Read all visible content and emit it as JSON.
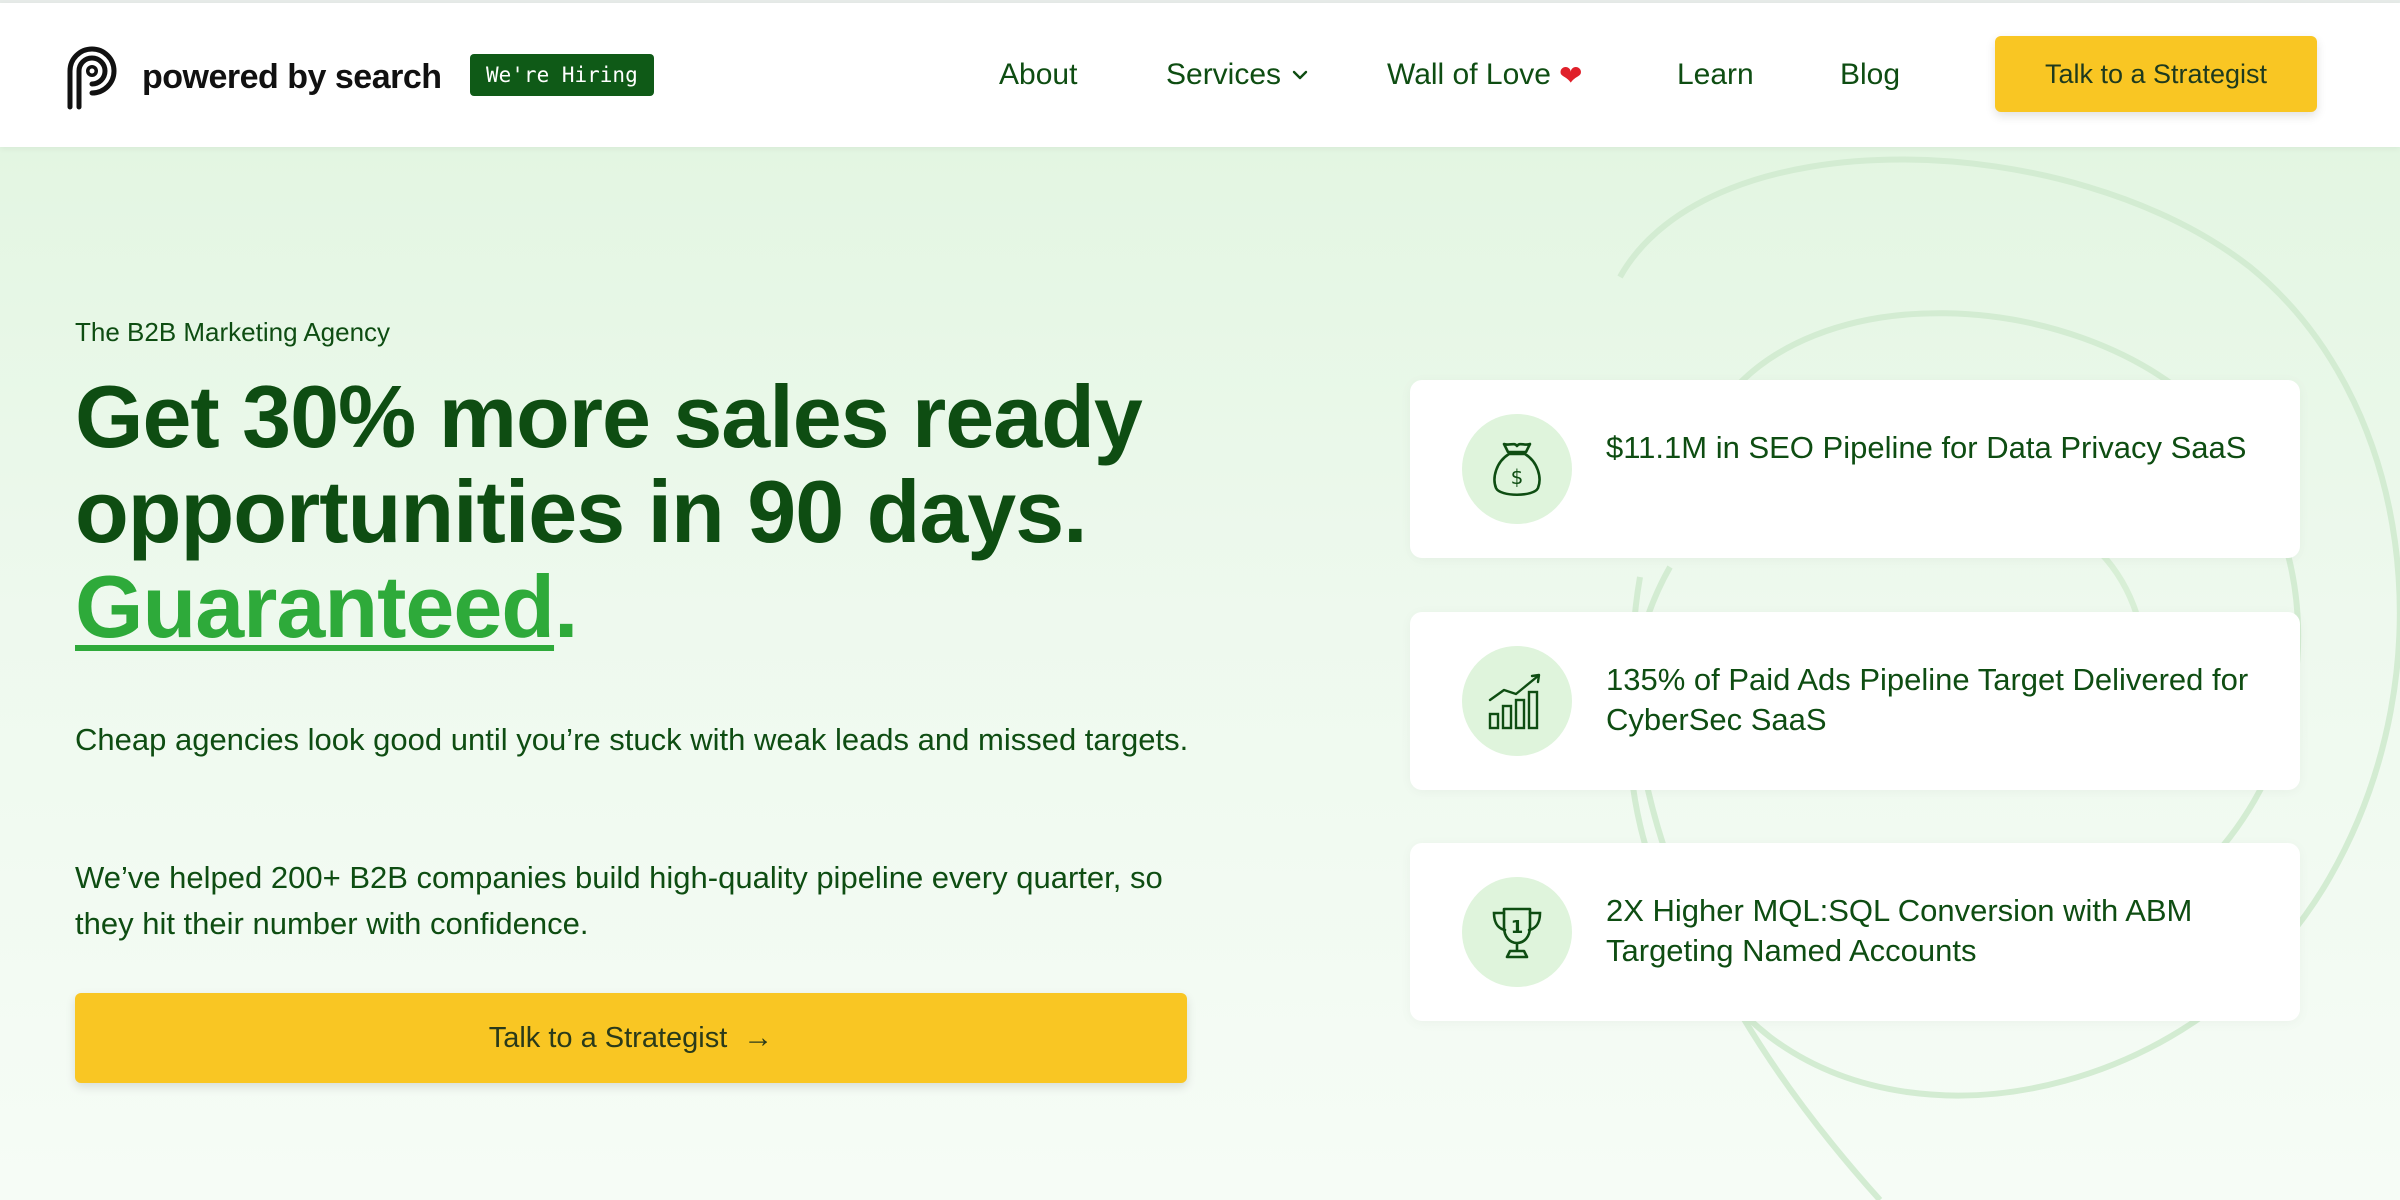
{
  "brand": {
    "name": "powered by search",
    "hiring_badge": "We're Hiring"
  },
  "nav": {
    "items": [
      {
        "label": "About"
      },
      {
        "label": "Services"
      },
      {
        "label": "Wall of Love"
      },
      {
        "label": "Learn"
      },
      {
        "label": "Blog"
      }
    ],
    "cta_label": "Talk to a Strategist"
  },
  "hero": {
    "eyebrow": "The B2B Marketing Agency",
    "headline_line1": "Get 30% more sales ready",
    "headline_line2": "opportunities in 90 days.",
    "headline_emphasis": "Guaranteed",
    "headline_period": ".",
    "paragraph1": "Cheap agencies look good until you’re stuck with weak leads and missed targets.",
    "paragraph2": "We’ve helped 200+ B2B companies build high-quality pipeline every quarter, so they hit their number with confidence.",
    "cta_label": "Talk to a Strategist",
    "cta_arrow": "→"
  },
  "results": [
    {
      "text": "$11.1M in SEO Pipeline for Data Privacy SaaS",
      "icon": "money-bag-icon"
    },
    {
      "text": "135% of Paid Ads Pipeline Target Delivered for CyberSec SaaS",
      "icon": "bar-chart-growth-icon"
    },
    {
      "text": "2X Higher MQL:SQL Conversion with ABM Targeting Named Accounts",
      "icon": "trophy-icon"
    }
  ],
  "colors": {
    "brand_green": "#0e4d12",
    "accent_green": "#2eaa3a",
    "cta_yellow": "#f9c623",
    "hiring_badge_bg": "#0f5a17",
    "hero_bg": "#e3f6e2",
    "heart": "#e0202a"
  }
}
